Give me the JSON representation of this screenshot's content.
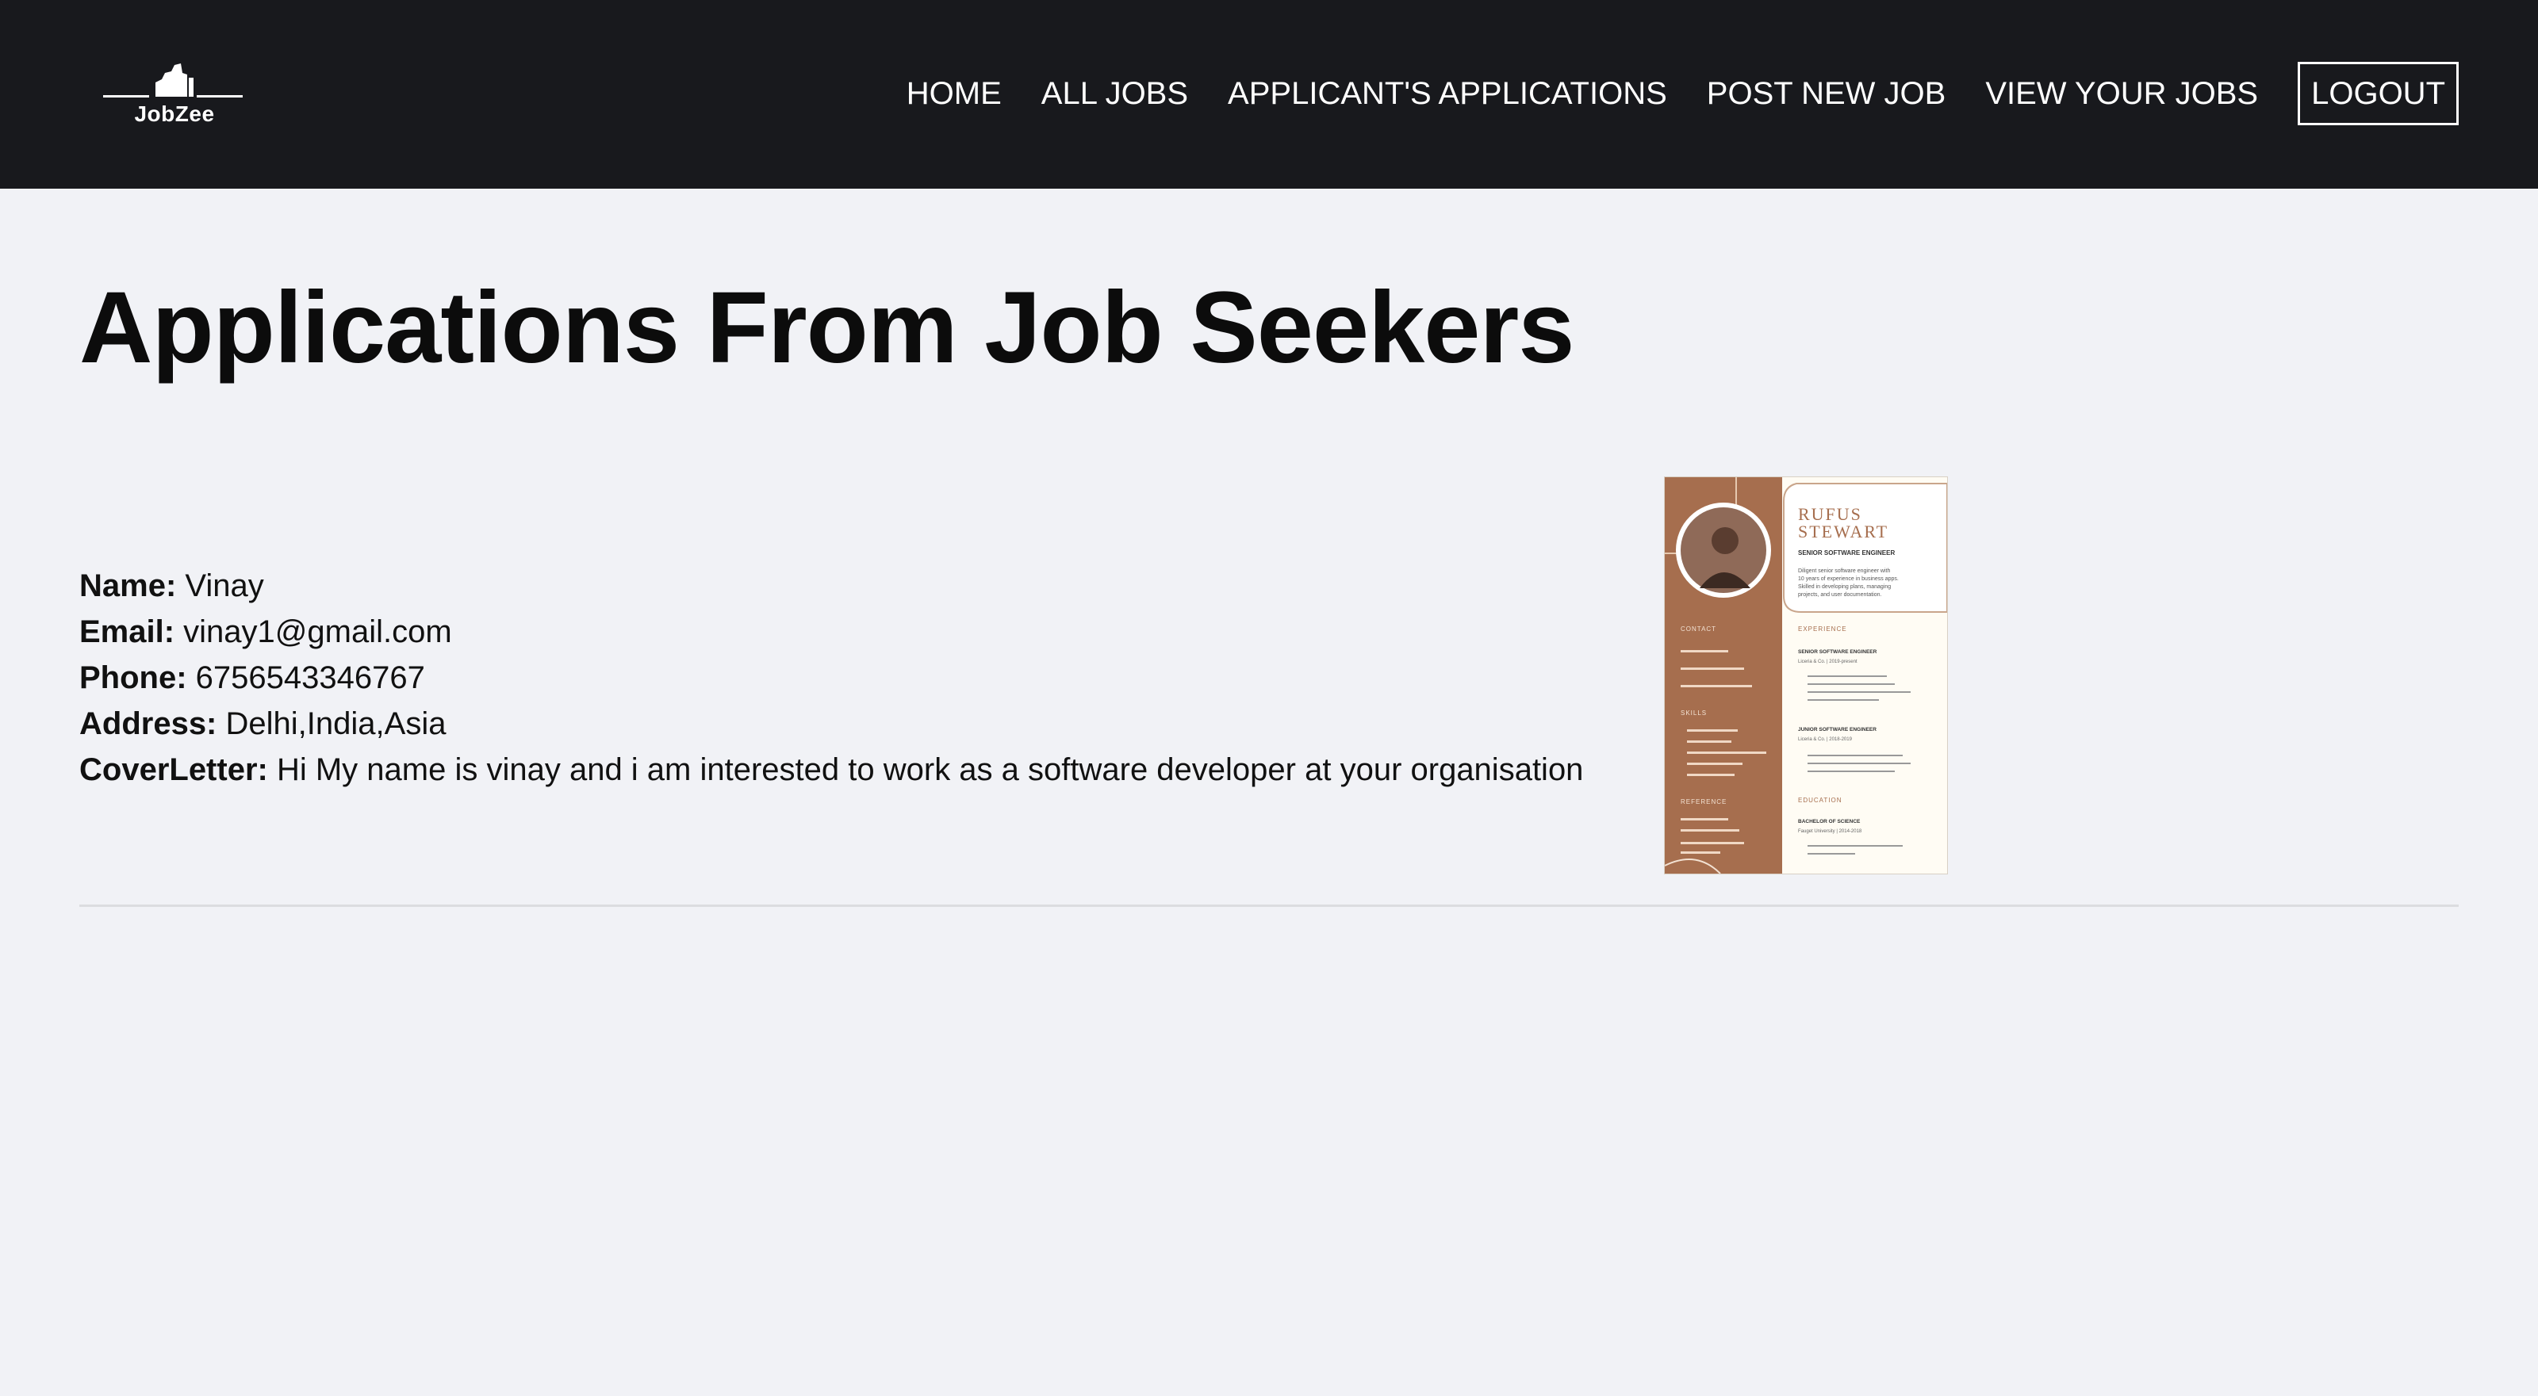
{
  "brand": {
    "name": "JobZee"
  },
  "nav": {
    "home": "HOME",
    "all_jobs": "ALL JOBS",
    "applicants_applications": "APPLICANT'S APPLICATIONS",
    "post_new_job": "POST NEW JOB",
    "view_your_jobs": "VIEW YOUR JOBS",
    "logout": "LOGOUT"
  },
  "page": {
    "title": "Applications From Job Seekers"
  },
  "application": {
    "name_label": "Name:",
    "name": "Vinay",
    "email_label": "Email:",
    "email": "vinay1@gmail.com",
    "phone_label": "Phone:",
    "phone": "6756543346767",
    "address_label": "Address:",
    "address": "Delhi,India,Asia",
    "cover_label": "CoverLetter:",
    "cover_letter": "Hi My name is vinay and i am interested to work as a software developer at your organisation"
  },
  "resume": {
    "name_line1": "RUFUS",
    "name_line2": "STEWART",
    "role": "SENIOR SOFTWARE ENGINEER",
    "summary": [
      "Diligent senior software engineer with",
      "10 years of experience in business apps.",
      "Skilled in developing plans, managing",
      "projects, and user documentation."
    ],
    "contact_heading": "CONTACT",
    "skills_heading": "SKILLS",
    "reference_heading": "REFERENCE",
    "experience_heading": "EXPERIENCE",
    "job1_title": "SENIOR SOFTWARE ENGINEER",
    "job1_meta": "Liceria & Co. | 2019-present",
    "job2_title": "JUNIOR SOFTWARE ENGINEER",
    "job2_meta": "Liceria & Co. | 2018-2019",
    "education_heading": "EDUCATION",
    "degree": "BACHELOR OF SCIENCE",
    "school": "Fauget University | 2014-2018",
    "accent_color": "#a66e4e"
  }
}
